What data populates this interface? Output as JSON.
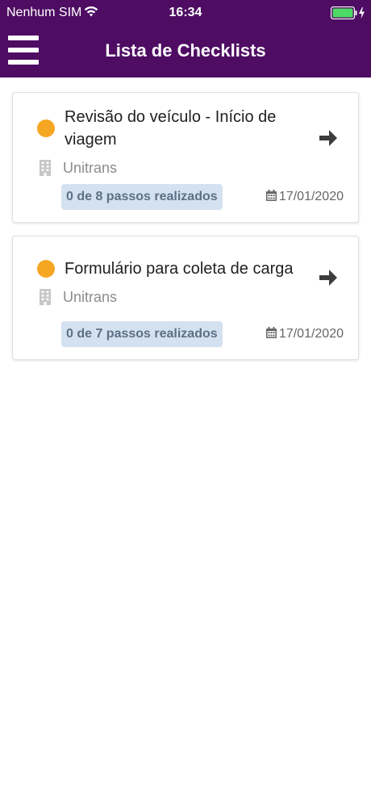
{
  "status_bar": {
    "carrier": "Nenhum SIM",
    "time": "16:34",
    "icons": [
      "wifi-icon",
      "battery-icon"
    ]
  },
  "header": {
    "title": "Lista de Checklists",
    "menu_icon": "hamburger-menu-icon",
    "background_color": "#4e0d63"
  },
  "checklists": [
    {
      "title": "Revisão do veículo - Início de viagem",
      "company": "Unitrans",
      "progress": "0 de 8 passos realizados",
      "date": "17/01/2020",
      "status_color": "#f5a623"
    },
    {
      "title": "Formulário para coleta de carga",
      "company": "Unitrans",
      "progress": "0 de 7 passos realizados",
      "date": "17/01/2020",
      "status_color": "#f5a623"
    }
  ]
}
